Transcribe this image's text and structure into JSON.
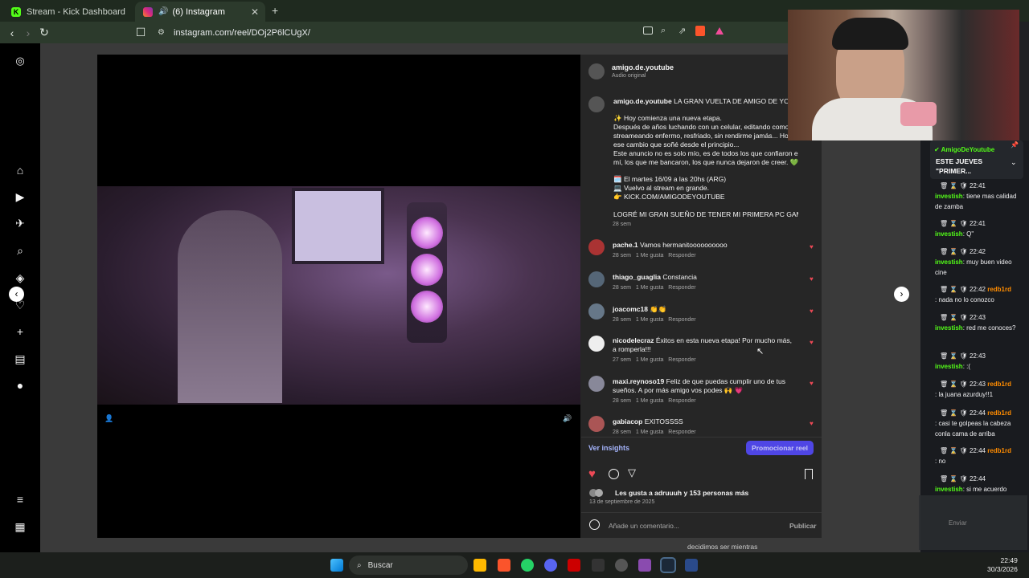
{
  "browser": {
    "tabs": [
      {
        "label": "Stream - Kick Dashboard",
        "icon": "kick-icon"
      },
      {
        "label": "(6) Instagram",
        "icon": "instagram-icon"
      }
    ],
    "url": "instagram.com/reel/DOj2P6lCUgX/"
  },
  "post": {
    "author": "amigo.de.youtube",
    "audio": "Audio original",
    "caption_user": "amigo.de.youtube",
    "caption_lines": [
      "LA GRAN VUELTA DE AMIGO DE YOUTU",
      "✨ Hoy comienza una nueva etapa.",
      "Después de años luchando con un celular, editando como",
      "streameando enfermo, resfriado, sin rendirme jamás... Hoy l",
      "ese cambio que soñé desde el principio...",
      "Este anuncio no es solo mío, es de todos los que confiaron en",
      "mí, los que me bancaron, los que nunca dejaron de creer. 💚",
      "🗓️ El martes 16/09 a las 20hs (ARG)",
      "💻 Vuelvo al stream en grande.",
      "👉 KICK.COM/AMIGODEYOUTUBE",
      "LOGRÉ MI GRAN SUEÑO DE TENER MI PRIMERA PC GAMER..."
    ],
    "caption_time": "28 sem",
    "comments": [
      {
        "user": "pache.1",
        "text": "Vamos hermanitoooooooooo",
        "time": "28 sem",
        "likes": "1 Me gusta",
        "reply": "Responder"
      },
      {
        "user": "thiago_guaglia",
        "text": "Constancia",
        "time": "28 sem",
        "likes": "1 Me gusta",
        "reply": "Responder"
      },
      {
        "user": "joacomc18",
        "text": "👏👏",
        "time": "28 sem",
        "likes": "1 Me gusta",
        "reply": "Responder"
      },
      {
        "user": "nicodelecraz",
        "text": "Éxitos en esta nueva etapa! Por mucho más, a romperla!!!",
        "time": "27 sem",
        "likes": "1 Me gusta",
        "reply": "Responder"
      },
      {
        "user": "maxi.reynoso19",
        "text": "Feliz de que puedas cumplir uno de tus sueños. A por más amigo vos podes 🙌 💗",
        "time": "28 sem",
        "likes": "1 Me gusta",
        "reply": "Responder"
      },
      {
        "user": "gabiacop",
        "text": "EXITOSSSS",
        "time": "28 sem",
        "likes": "1 Me gusta",
        "reply": "Responder"
      }
    ],
    "insights": "Ver insights",
    "promote": "Promocionar reel",
    "likes_text": "Les gusta a adruuuh y 153 personas más",
    "date": "13 de septiembre de 2025",
    "comment_placeholder": "Añade un comentario...",
    "publish": "Publicar"
  },
  "chat": {
    "pinned_user": "AmigoDeYoutube",
    "pinned_text": "ESTE JUEVES \"PRIMER...",
    "messages": [
      {
        "time": "22:41",
        "user": "investish",
        "text": ": tiene mas calidad de zamba"
      },
      {
        "time": "22:41",
        "user": "investish",
        "text": ": Q\""
      },
      {
        "time": "22:42",
        "user": "investish",
        "text": ": muy buen video cine"
      },
      {
        "time": "22:42",
        "user": "redb1rd",
        "text": ": nada no lo conozco"
      },
      {
        "time": "22:43",
        "user": "investish",
        "text": ": red me conoces?"
      },
      {
        "time": "22:43",
        "user": "investish",
        "text": ": :("
      },
      {
        "time": "22:43",
        "user": "redb1rd",
        "text": ": la juana azurduy!!1"
      },
      {
        "time": "22:44",
        "user": "redb1rd",
        "text": ": casi te golpeas la cabeza conla cama de arriba"
      },
      {
        "time": "22:44",
        "user": "redb1rd",
        "text": ": no"
      },
      {
        "time": "22:44",
        "user": "investish",
        "text": ": si me acuerdo"
      }
    ],
    "send": "Enviar"
  },
  "overlay": {
    "kick_count": "9",
    "caption_text": "decidimos ser mientras"
  },
  "taskbar": {
    "search": "Buscar",
    "time": "22:49",
    "date": "30/3/2026"
  },
  "colors": {
    "like": "#ed4956",
    "kick": "#53fc18",
    "promote": "#4f46e5",
    "insights": "#a5b4fc"
  }
}
